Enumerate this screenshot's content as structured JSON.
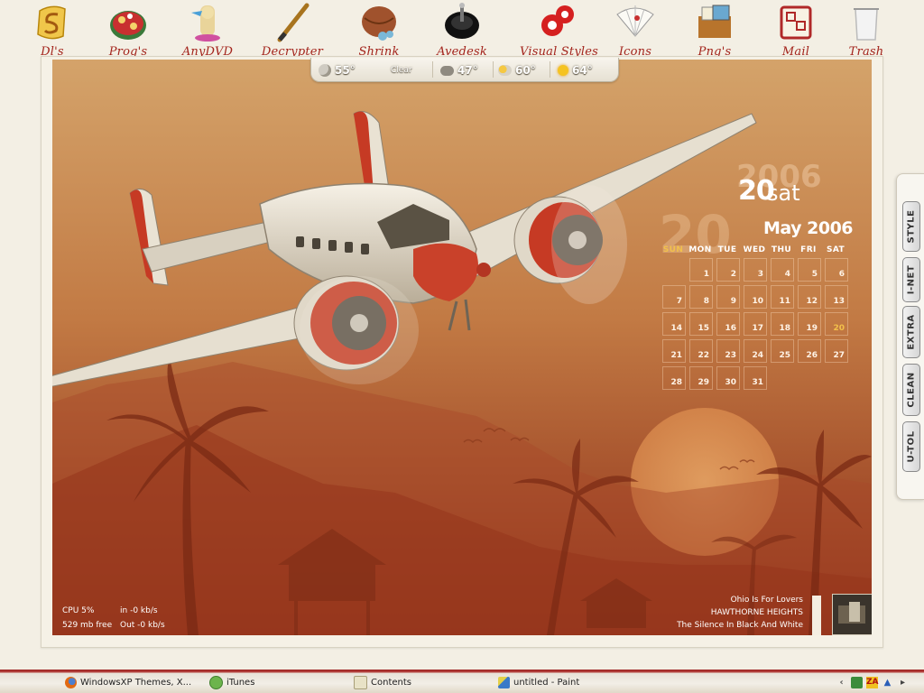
{
  "dock": {
    "items": [
      {
        "label": "Dl's",
        "icon": "folder-s-icon"
      },
      {
        "label": "Prog's",
        "icon": "gift-box-icon"
      },
      {
        "label": "AnyDVD",
        "icon": "fox-icon"
      },
      {
        "label": "Decrypter",
        "icon": "pen-icon"
      },
      {
        "label": "Shrink",
        "icon": "ball-icon"
      },
      {
        "label": "Avedesk",
        "icon": "spinning-top-icon"
      },
      {
        "label": "Visual Styles",
        "icon": "red-fan-icon"
      },
      {
        "label": "Icons",
        "icon": "hand-fan-icon"
      },
      {
        "label": "Png's",
        "icon": "photos-box-icon"
      },
      {
        "label": "Mail",
        "icon": "scroll-icon"
      },
      {
        "label": "Trash",
        "icon": "trash-bin-icon"
      }
    ]
  },
  "weather": {
    "current": "55°",
    "current_condition": "Clear",
    "forecast": [
      {
        "temp": "47°",
        "icon": "storm-cloud-icon"
      },
      {
        "temp": "60°",
        "icon": "partly-cloudy-icon"
      },
      {
        "temp": "64°",
        "icon": "sun-icon"
      }
    ]
  },
  "calendar": {
    "year_watermark": "2006",
    "day_number": "20",
    "day_name": "sat",
    "day_watermark": "20",
    "month_title": "May 2006",
    "weekdays": [
      "SUN",
      "MON",
      "TUE",
      "WED",
      "THU",
      "FRI",
      "SAT"
    ],
    "highlight_weekday": "SUN",
    "days": [
      [
        "",
        "1",
        "2",
        "3",
        "4",
        "5",
        "6"
      ],
      [
        "7",
        "8",
        "9",
        "10",
        "11",
        "12",
        "13"
      ],
      [
        "14",
        "15",
        "16",
        "17",
        "18",
        "19",
        "20"
      ],
      [
        "21",
        "22",
        "23",
        "24",
        "25",
        "26",
        "27"
      ],
      [
        "28",
        "29",
        "30",
        "31",
        "",
        "",
        ""
      ]
    ],
    "today": "20",
    "colors": {
      "accent": "#f2c04a",
      "text": "#ffffff"
    }
  },
  "system": {
    "cpu": "CPU 5%",
    "memory": "529 mb free",
    "net_in": "in  -0 kb/s",
    "net_out": "Out -0 kb/s"
  },
  "now_playing": {
    "song": "Ohio Is For Lovers",
    "artist": "HAWTHORNE HEIGHTS",
    "album": "The Silence In Black And White"
  },
  "side_panel": {
    "tabs": [
      "STYLE",
      "I-NET",
      "EXTRA",
      "CLEAN",
      "U-TOL"
    ]
  },
  "taskbar": {
    "buttons": [
      {
        "label": "WindowsXP Themes, X...",
        "icon": "firefox-icon"
      },
      {
        "label": "iTunes",
        "icon": "itunes-icon"
      },
      {
        "label": "Contents",
        "icon": "folder-icon"
      },
      {
        "label": "untitled - Paint",
        "icon": "paint-icon"
      }
    ],
    "tray": [
      {
        "icon": "collapse-arrow-icon"
      },
      {
        "icon": "network-icon"
      },
      {
        "icon": "zonealarm-icon",
        "text": "ZA"
      },
      {
        "icon": "antivirus-icon"
      },
      {
        "icon": "speaker-icon"
      }
    ]
  },
  "colors": {
    "dock_label": "#a3241c",
    "taskbar_accent": "#9a1c1c",
    "wallpaper_top": "#c98a4d",
    "wallpaper_bottom": "#8d2e18"
  }
}
